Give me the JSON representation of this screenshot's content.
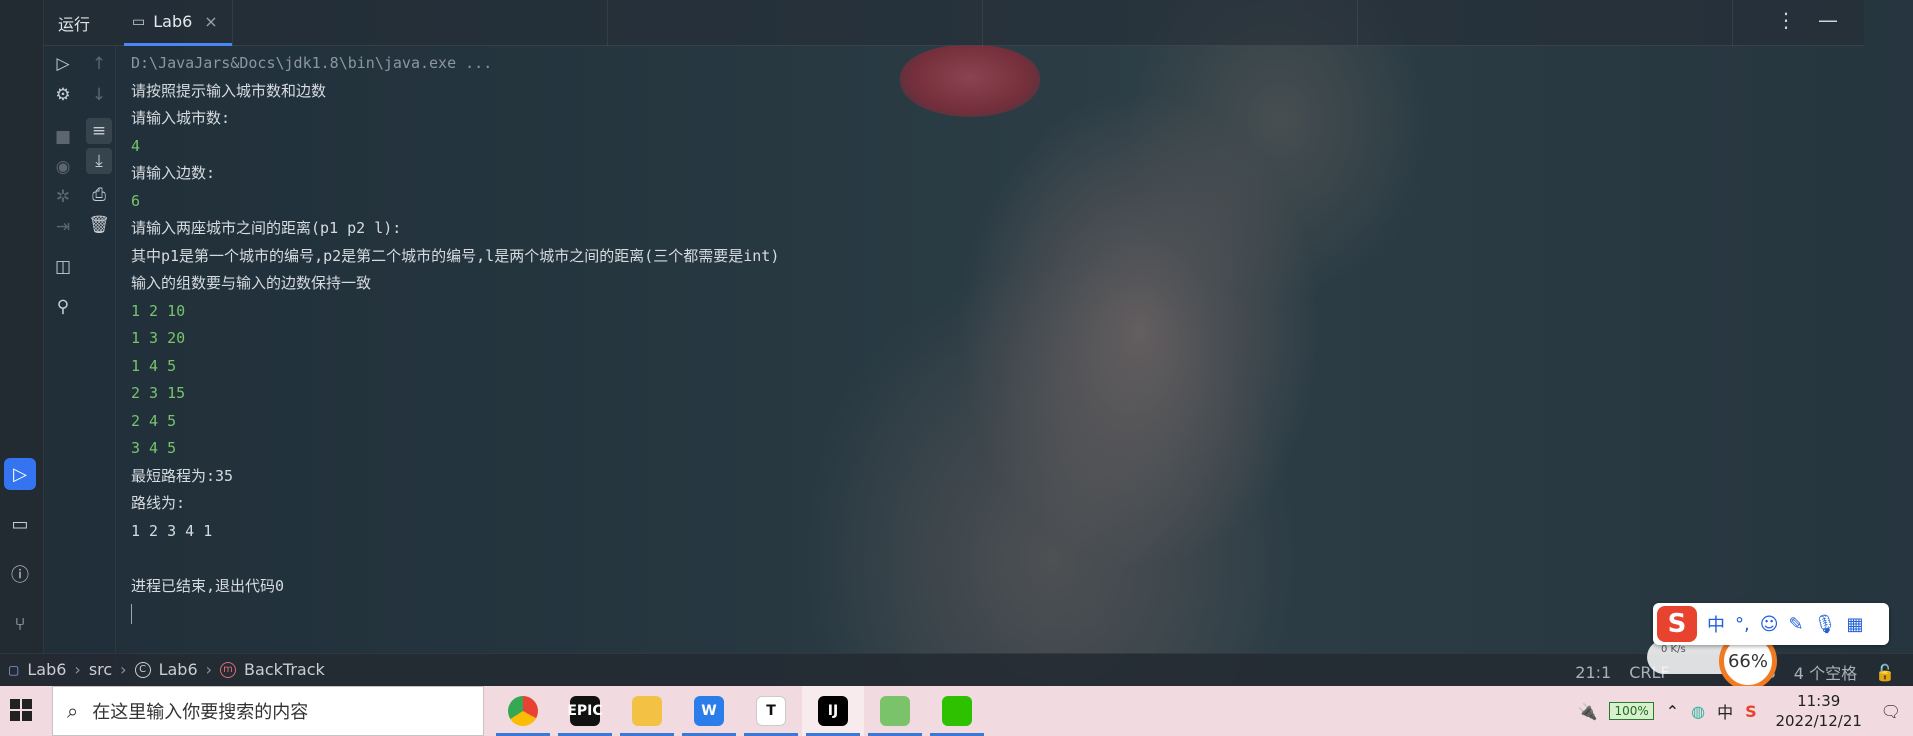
{
  "run_tab": {
    "run_label": "运行",
    "tab_label": "Lab6"
  },
  "console": {
    "lines": [
      {
        "text": "D:\\JavaJars&Docs\\jdk1.8\\bin\\java.exe ...",
        "kind": "gray"
      },
      {
        "text": "请按照提示输入城市数和边数",
        "kind": "out"
      },
      {
        "text": "请输入城市数:",
        "kind": "out"
      },
      {
        "text": "4",
        "kind": "in"
      },
      {
        "text": "请输入边数:",
        "kind": "out"
      },
      {
        "text": "6",
        "kind": "in"
      },
      {
        "text": "请输入两座城市之间的距离(p1 p2 l):",
        "kind": "out"
      },
      {
        "text": "其中p1是第一个城市的编号,p2是第二个城市的编号,l是两个城市之间的距离(三个都需要是int)",
        "kind": "out"
      },
      {
        "text": "输入的组数要与输入的边数保持一致",
        "kind": "out"
      },
      {
        "text": "1 2 10",
        "kind": "in"
      },
      {
        "text": "1 3 20",
        "kind": "in"
      },
      {
        "text": "1 4 5",
        "kind": "in"
      },
      {
        "text": "2 3 15",
        "kind": "in"
      },
      {
        "text": "2 4 5",
        "kind": "in"
      },
      {
        "text": "3 4 5",
        "kind": "in"
      },
      {
        "text": "最短路程为:35",
        "kind": "out"
      },
      {
        "text": "路线为:",
        "kind": "out"
      },
      {
        "text": "1 2 3 4 1",
        "kind": "out"
      },
      {
        "text": "",
        "kind": "out"
      },
      {
        "text": "进程已结束,退出代码0",
        "kind": "out"
      }
    ]
  },
  "statusbar": {
    "crumbs": [
      "Lab6",
      "src",
      "Lab6",
      "BackTrack"
    ],
    "position": "21:1",
    "line_sep": "CRLF",
    "encoding": "8",
    "indent": "4 个空格"
  },
  "ime": {
    "logo": "S",
    "mode": "中",
    "punct": "°,",
    "net_speed": "0  K/s",
    "percent": "66%"
  },
  "taskbar": {
    "search_placeholder": "在这里输入你要搜索的内容",
    "apps": [
      {
        "name": "chrome",
        "label": "",
        "color": "#e94235"
      },
      {
        "name": "epic-games",
        "label": "EPIC",
        "color": "#111111"
      },
      {
        "name": "file-explorer",
        "label": "",
        "color": "#f3c244"
      },
      {
        "name": "wps",
        "label": "W",
        "color": "#2b7de9"
      },
      {
        "name": "typora",
        "label": "T",
        "color": "#ffffff"
      },
      {
        "name": "intellij",
        "label": "IJ",
        "color": "#000000"
      },
      {
        "name": "app-diamond",
        "label": "",
        "color": "#7ac36a"
      },
      {
        "name": "wechat",
        "label": "",
        "color": "#2dc100"
      }
    ],
    "battery": "100%",
    "ime_indicator": "中",
    "time": "11:39",
    "date": "2022/12/21"
  }
}
